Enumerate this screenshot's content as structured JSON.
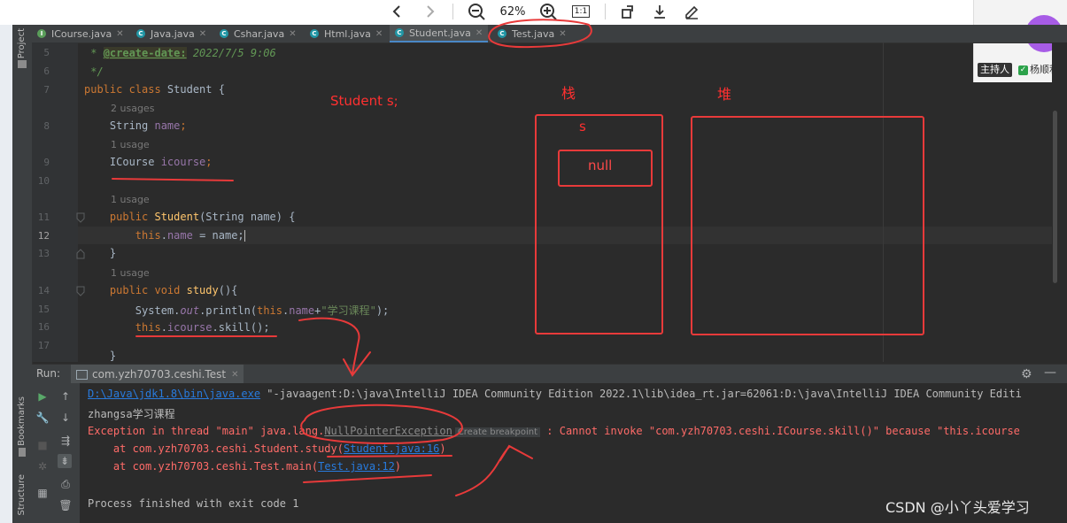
{
  "viewer": {
    "zoom": "62%",
    "zoom_out_icon": "zoom-out-icon",
    "zoom_in_icon": "zoom-in-icon",
    "actual_size_label": "1:1"
  },
  "video": {
    "avatar_text": "顺利",
    "host_tag": "主持人",
    "host_name": "杨顺利"
  },
  "ide": {
    "left_tools": [
      "Project",
      "Bookmarks",
      "Structure"
    ],
    "tabs": [
      {
        "label": "ICourse.java",
        "active": false
      },
      {
        "label": "Java.java",
        "active": false
      },
      {
        "label": "Cshar.java",
        "active": false
      },
      {
        "label": "Html.java",
        "active": false
      },
      {
        "label": "Student.java",
        "active": true
      },
      {
        "label": "Test.java",
        "active": false
      }
    ],
    "line_numbers": [
      "5",
      "6",
      "7",
      "8",
      "9",
      "10",
      "11",
      "12",
      "13",
      "14",
      "15",
      "16",
      "17"
    ],
    "hints": {
      "h1": "2 usages",
      "h2": "1 usage",
      "h3": "1 usage",
      "h4": "1 usage"
    },
    "code": {
      "l5a": " * ",
      "l5tag": "@create-date:",
      "l5b": " 2022/7/5 9:06",
      "l6": " */",
      "l7kw": "public class ",
      "l7b": "Student {",
      "l8a": "    String ",
      "l8f": "name",
      "l8b": ";",
      "l9a": "    ICourse ",
      "l9f": "icourse",
      "l9b": ";",
      "l11kw": "    public ",
      "l11fn": "Student",
      "l11b": "(String name) {",
      "l12kw": "        this",
      "l12a": ".",
      "l12f": "name",
      "l12b": " = name;",
      "l13": "    }",
      "l14kw": "    public void ",
      "l14fn": "study",
      "l14b": "(){",
      "l15a": "        System.",
      "l15f": "out",
      "l15b": ".println(",
      "l15kw": "this",
      "l15c": ".",
      "l15f2": "name",
      "l15d": "+",
      "l15s": "\"学习课程\"",
      "l15e": ");",
      "l16kw": "        this",
      "l16a": ".",
      "l16f": "icourse",
      "l16b": ".skill();",
      "l17": "    }"
    }
  },
  "run": {
    "label": "Run:",
    "config_tab": "com.yzh70703.ceshi.Test",
    "lines": {
      "cmd_link": "D:\\Java\\jdk1.8\\bin\\java.exe",
      "cmd_rest": " \"-javaagent:D:\\java\\IntelliJ IDEA Community Edition 2022.1\\lib\\idea_rt.jar=62061:D:\\java\\IntelliJ IDEA Community Editi",
      "out1": "zhangsa学习课程",
      "ex_a": "Exception in thread \"main\" java.lang.",
      "ex_link": "NullPointerException",
      "ex_bp": "Create breakpoint",
      "ex_b": " : Cannot invoke \"com.yzh70703.ceshi.ICourse.skill()\" because \"this.icourse",
      "st1a": "    at com.yzh70703.ceshi.Student.study(",
      "st1link": "Student.java:16",
      "st1b": ")",
      "st2a": "    at com.yzh70703.ceshi.Test.main(",
      "st2link": "Test.java:12",
      "st2b": ")",
      "finish": "Process finished with exit code 1"
    }
  },
  "annotations": {
    "decl": "Student s;",
    "stack": "栈",
    "heap": "堆",
    "var": "s",
    "null_val": "null"
  },
  "watermark": "CSDN @小丫头爱学习",
  "colors": {
    "accent": "#4a88c7",
    "annotation": "#ff3030",
    "error": "#ff6b68",
    "link": "#287bde"
  }
}
